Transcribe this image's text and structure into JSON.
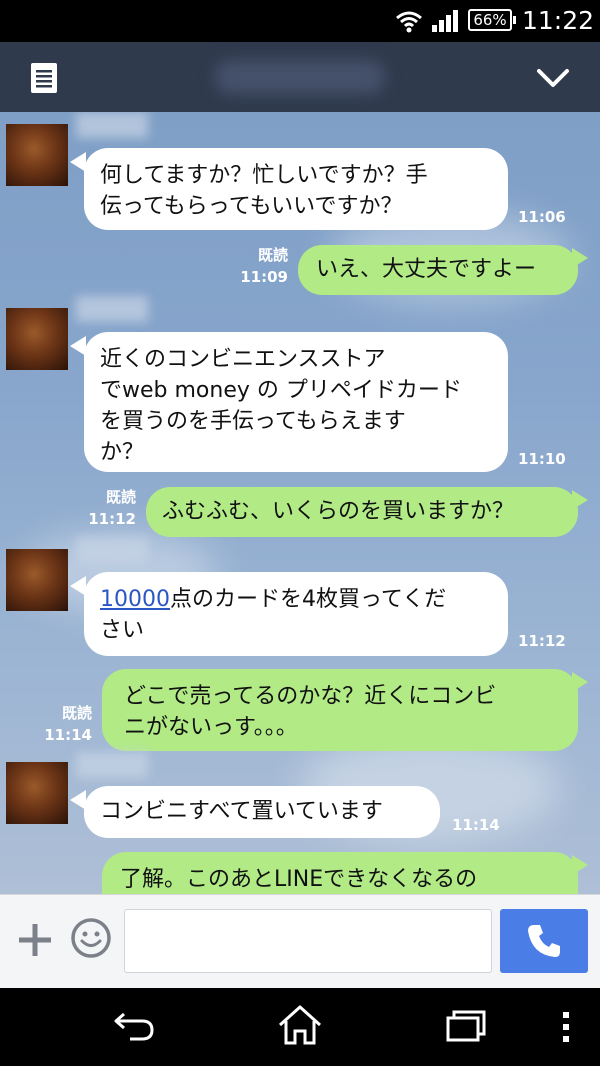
{
  "status_bar": {
    "battery": "66%",
    "time": "11:22"
  },
  "messages": [
    {
      "direction": "in",
      "text": "何してますか？忙しいですか？手\n伝ってもらってもいいですか？",
      "time": "11:06"
    },
    {
      "direction": "out",
      "text": "いえ、大丈夫ですよー",
      "read": "既読",
      "time": "11:09"
    },
    {
      "direction": "in",
      "text": "近くのコンビニエンスストア\nでweb money の プリペイドカード\nを買うのを手伝ってもらえます\nか？",
      "time": "11:10"
    },
    {
      "direction": "out",
      "text": "ふむふむ、いくらのを買いますか？",
      "read": "既読",
      "time": "11:12"
    },
    {
      "direction": "in",
      "link_text": "10000",
      "text": "点のカードを4枚買ってくだ\nさい",
      "time": "11:12"
    },
    {
      "direction": "out",
      "text": "どこで売ってるのかな？近くにコンビ\nニがないっす。。。",
      "read": "既読",
      "time": "11:14"
    },
    {
      "direction": "in",
      "text": "コンビニすべて置いています",
      "time": "11:14"
    },
    {
      "direction": "out",
      "text": "了解。このあとLINEできなくなるの"
    }
  ],
  "icons": {
    "header_left": "menu-icon",
    "header_right": "chevron-down-icon",
    "input_left": "plus-icon",
    "input_emoji": "smiley-icon",
    "call": "phone-icon",
    "nav": [
      "back-icon",
      "home-icon",
      "recents-icon",
      "more-icon"
    ]
  },
  "colors": {
    "header": "#2f3a4d",
    "incoming_bubble": "#ffffff",
    "outgoing_bubble": "#b2ea86",
    "call_button": "#4a7de6",
    "link": "#2b57c4"
  }
}
